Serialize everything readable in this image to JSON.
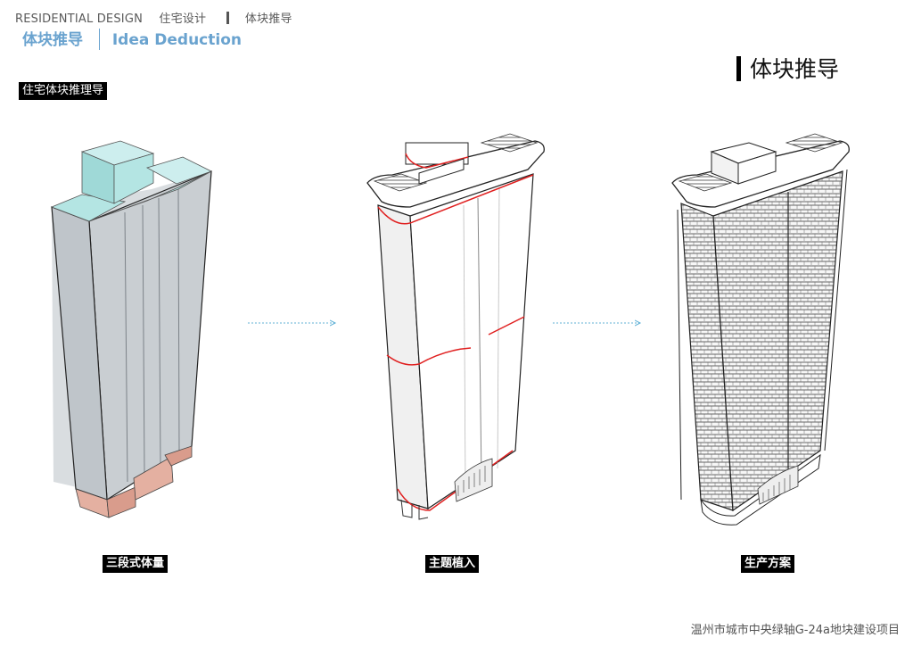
{
  "header": {
    "brand": "RESIDENTIAL DESIGN",
    "category": "住宅设计",
    "section": "体块推导"
  },
  "subtitle": {
    "cn": "体块推导",
    "en": "Idea Deduction"
  },
  "page_heading": "体块推导",
  "intro_tag": "住宅体块推理导",
  "steps": [
    {
      "caption": "三段式体量"
    },
    {
      "caption": "主题植入"
    },
    {
      "caption": "生产方案"
    }
  ],
  "footer": "温州市城市中央绿轴G-24a地块建设项目",
  "colors": {
    "accent_blue": "#6aa3cf",
    "mass_gray": "#c9ced2",
    "roof_cyan": "#b4e5e3",
    "base_salmon": "#e4b0a1",
    "highlight_red": "#e02020",
    "arrow_blue": "#5fb0d6"
  }
}
